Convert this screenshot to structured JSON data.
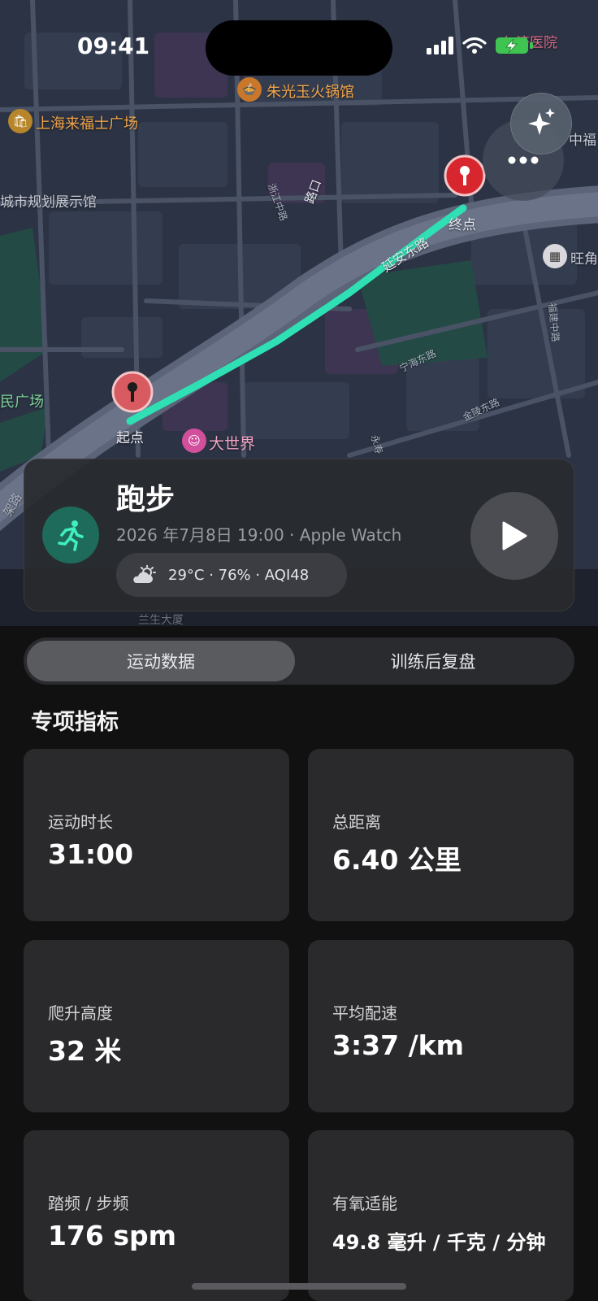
{
  "status_bar": {
    "time": "09:41"
  },
  "map": {
    "labels": {
      "hotpot": "朱光玉火锅馆",
      "plaza": "上海来福士广场",
      "planning_hall": "城市规划展示馆",
      "peoples_square": "民广场",
      "hospital": "仁济医院",
      "fuzhou": "中福",
      "wang": "旺角",
      "great_world": "大世界",
      "end": "终点",
      "start": "起点",
      "yanan_road": "延安东路",
      "zhejiang_road": "浙江中路",
      "ningbo_road": "宁海东路",
      "jinling_road": "金陵东路",
      "fujian_road": "福建中路",
      "road_mid": "路口",
      "road_yong": "永寿",
      "road_jiapu": "架路",
      "bottom_cut": "兰生大厦"
    }
  },
  "workout": {
    "title": "跑步",
    "meta": "2026 年7月8日 19:00 · Apple Watch",
    "weather": "29°C · 76% · AQI48"
  },
  "tabs": {
    "active": "运动数据",
    "inactive": "训练后复盘"
  },
  "section": {
    "title": "专项指标"
  },
  "metrics": [
    {
      "label": "运动时长",
      "value": "31:00"
    },
    {
      "label": "总距离",
      "value": "6.40 公里"
    },
    {
      "label": "爬升高度",
      "value": "32 米"
    },
    {
      "label": "平均配速",
      "value": "3:37 /km"
    },
    {
      "label": "踏频 / 步频",
      "value": "176 spm"
    },
    {
      "label": "有氧适能",
      "value": "49.8 毫升 / 千克 / 分钟"
    }
  ],
  "colors": {
    "route": "#2fe0b4",
    "pin": "#d9363e",
    "accent": "#1e6b5b"
  }
}
